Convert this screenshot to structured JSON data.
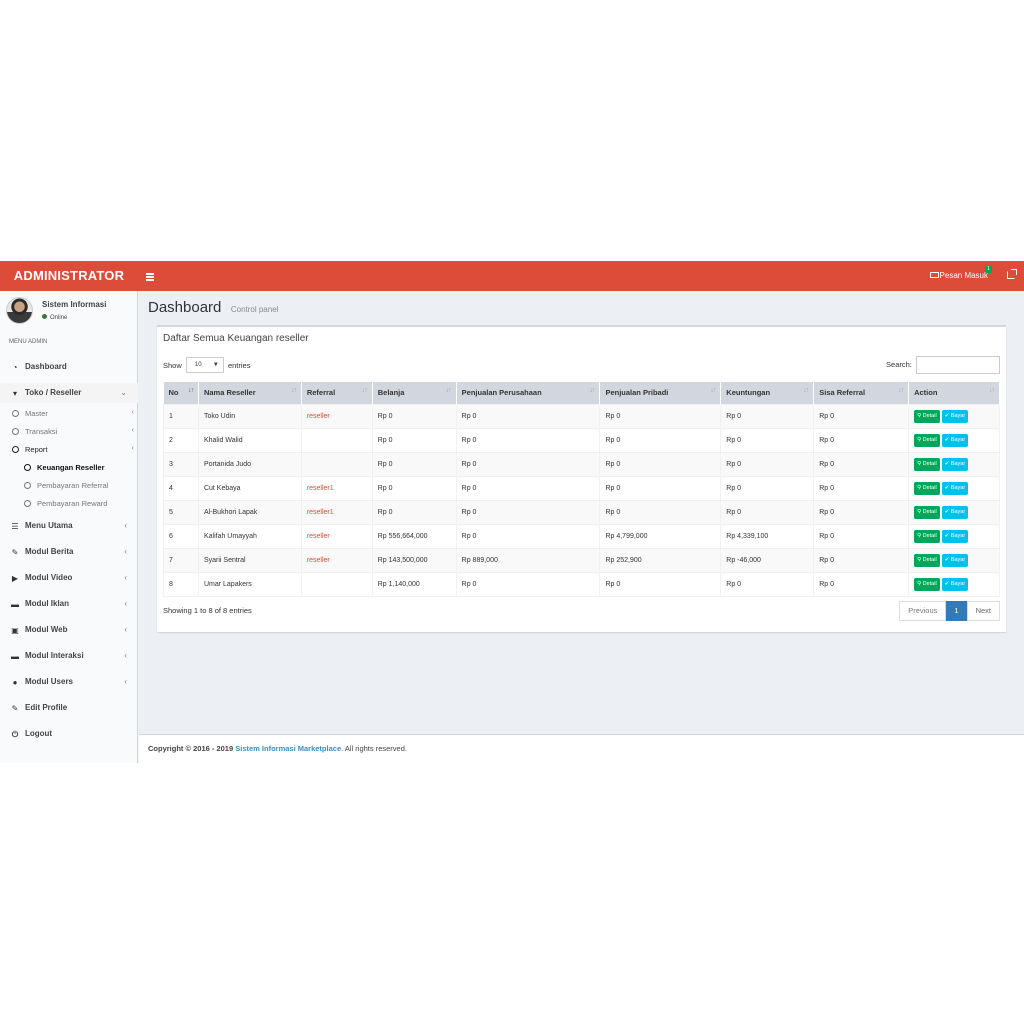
{
  "header": {
    "logo": "ADMINISTRATOR",
    "messages_label": "Pesan Masuk",
    "messages_count": "1"
  },
  "user": {
    "name": "Sistem Informasi",
    "status": "Online"
  },
  "sidebar": {
    "section_header": "MENU ADMIN",
    "items": [
      {
        "label": "Dashboard",
        "icon": "dashboard-icon"
      },
      {
        "label": "Toko / Reseller",
        "icon": "cart-icon"
      },
      {
        "label": "Menu Utama",
        "icon": "list-icon"
      },
      {
        "label": "Modul Berita",
        "icon": "pencil-icon"
      },
      {
        "label": "Modul Video",
        "icon": "play-icon"
      },
      {
        "label": "Modul Iklan",
        "icon": "desktop-icon"
      },
      {
        "label": "Modul Web",
        "icon": "image-icon"
      },
      {
        "label": "Modul Interaksi",
        "icon": "desktop-icon"
      },
      {
        "label": "Modul Users",
        "icon": "users-icon"
      },
      {
        "label": "Edit Profile",
        "icon": "edit-icon"
      },
      {
        "label": "Logout",
        "icon": "power-icon"
      }
    ],
    "toko_sub": [
      {
        "label": "Master"
      },
      {
        "label": "Transaksi"
      },
      {
        "label": "Report"
      }
    ],
    "report_sub": [
      {
        "label": "Keuangan Reseller"
      },
      {
        "label": "Pembayaran Referral"
      },
      {
        "label": "Pembayaran Reward"
      }
    ]
  },
  "page": {
    "title": "Dashboard",
    "subtitle": "Control panel"
  },
  "box": {
    "title": "Daftar Semua Keuangan reseller",
    "show_label": "Show",
    "entries_value": "10",
    "entries_label": "entries",
    "search_label": "Search:",
    "info": "Showing 1 to 8 of 8 entries",
    "prev": "Previous",
    "page": "1",
    "next": "Next"
  },
  "table": {
    "columns": [
      "No",
      "Nama Reseller",
      "Referral",
      "Belanja",
      "Penjualan Perusahaan",
      "Penjualan Pribadi",
      "Keuntungan",
      "Sisa Referral",
      "Action"
    ],
    "rows": [
      [
        "1",
        "Toko Udin",
        "reseller",
        "Rp 0",
        "Rp 0",
        "Rp 0",
        "Rp 0",
        "Rp 0"
      ],
      [
        "2",
        "Khalid Walid",
        "",
        "Rp 0",
        "Rp 0",
        "Rp 0",
        "Rp 0",
        "Rp 0"
      ],
      [
        "3",
        "Portanida Judo",
        "",
        "Rp 0",
        "Rp 0",
        "Rp 0",
        "Rp 0",
        "Rp 0"
      ],
      [
        "4",
        "Cut Kebaya",
        "reseller1",
        "Rp 0",
        "Rp 0",
        "Rp 0",
        "Rp 0",
        "Rp 0"
      ],
      [
        "5",
        "Al-Bukhori Lapak",
        "reseller1",
        "Rp 0",
        "Rp 0",
        "Rp 0",
        "Rp 0",
        "Rp 0"
      ],
      [
        "6",
        "Kalifah Umayyah",
        "reseller",
        "Rp 556,664,000",
        "Rp 0",
        "Rp 4,799,000",
        "Rp 4,339,100",
        "Rp 0"
      ],
      [
        "7",
        "Syarii Sentral",
        "reseller",
        "Rp 143,500,000",
        "Rp 889,000",
        "Rp 252,900",
        "Rp -46,000",
        "Rp 0"
      ],
      [
        "8",
        "Umar Lapakers",
        "",
        "Rp 1,140,000",
        "Rp 0",
        "Rp 0",
        "Rp 0",
        "Rp 0"
      ]
    ],
    "detail_label": "Detail",
    "bayar_label": "Bayar"
  },
  "footer": {
    "prefix": "Copyright © 2016 - 2019",
    "brand": "Sistem Informasi Marketplace",
    "suffix": ". All rights reserved."
  },
  "colors": {
    "header": "#dd4b39",
    "detail": "#00a65a",
    "bayar": "#00c0ef",
    "referral_text": "#dd4b39",
    "active_page": "#337ab7"
  }
}
